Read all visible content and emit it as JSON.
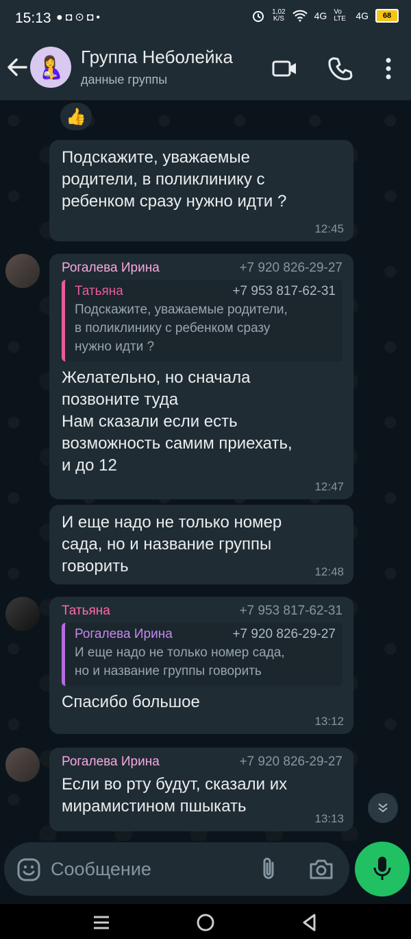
{
  "status_bar": {
    "time": "15:13",
    "notification_icons": "●◘⊙◘•",
    "net_speed_value": "1,02",
    "net_speed_unit": "K/S",
    "network_4g_1": "4G",
    "volte": "Vo LTE",
    "network_4g_2": "4G",
    "battery": "68"
  },
  "header": {
    "title": "Группа Неболейка",
    "subtitle": "данные группы",
    "avatar_emoji": "🤱"
  },
  "chat": {
    "reaction_emoji": "👍",
    "messages": [
      {
        "text": "Подскажите, уважаемые\nродители, в поликлинику с\nребенком сразу нужно идти ?",
        "time": "12:45"
      },
      {
        "sender": "Рогалева Ирина",
        "phone": "+7 920 826-29-27",
        "quote_sender": "Татьяна",
        "quote_phone": "+7 953 817-62-31",
        "quote_text": "Подскажите, уважаемые родители,\nв поликлинику с ребенком сразу\nнужно идти ?",
        "text": "Желательно, но сначала\nпозвоните туда\nНам сказали если есть\nвозможность самим приехать,\nи до 12",
        "time": "12:47"
      },
      {
        "text": "И еще надо не только номер\nсада, но и название группы\nговорить",
        "time": "12:48"
      },
      {
        "sender": "Татьяна",
        "phone": "+7 953 817-62-31",
        "quote_sender": "Рогалева Ирина",
        "quote_phone": "+7 920 826-29-27",
        "quote_text": "И еще надо не только номер сада,\nно и название группы говорить",
        "text": "Спасибо большое",
        "time": "13:12"
      },
      {
        "sender": "Рогалева Ирина",
        "phone": "+7 920 826-29-27",
        "text": "Если во рту будут, сказали их\nмирамистином пшыкать",
        "time": "13:13"
      }
    ]
  },
  "composer": {
    "placeholder": "Сообщение"
  },
  "colors": {
    "accent_green": "#21c063",
    "bubble": "#202c33",
    "background": "#0b141a"
  },
  "icons": [
    "back-arrow-icon",
    "video-call-icon",
    "phone-icon",
    "more-icon",
    "emoji-icon",
    "attach-icon",
    "camera-icon",
    "mic-icon",
    "chevron-down-icon",
    "menu-nav-icon",
    "home-nav-icon",
    "back-nav-icon"
  ]
}
